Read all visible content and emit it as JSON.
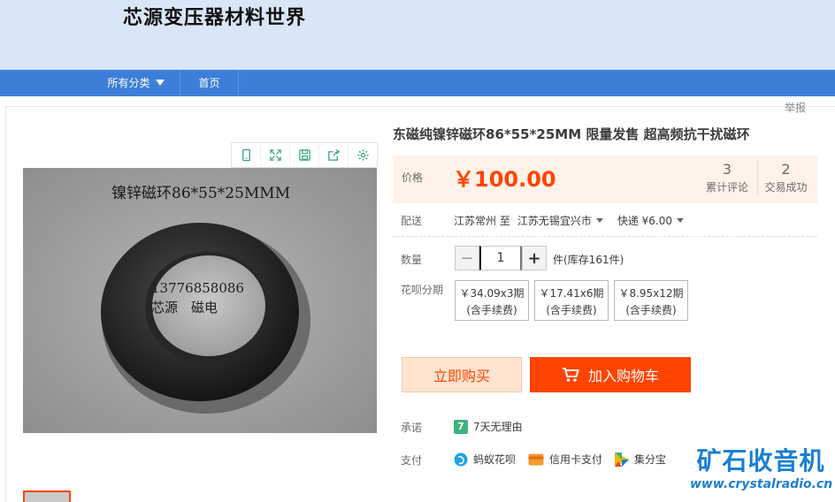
{
  "shop": {
    "title": "芯源变压器材料世界"
  },
  "nav": {
    "all_categories": "所有分类",
    "home": "首页"
  },
  "report_link": "举报",
  "toolbar": {
    "icons": [
      "phone-icon",
      "fullscreen-icon",
      "save-icon",
      "share-icon",
      "settings-icon"
    ]
  },
  "image": {
    "caption": "镍锌磁环86*55*25MMM",
    "overlay_line1": "13776858086",
    "overlay_line2": "芯源　磁电"
  },
  "product": {
    "title": "东磁纯镍锌磁环86*55*25MM 限量发售 超高频抗干扰磁环"
  },
  "price": {
    "label": "价格",
    "value": "￥100.00",
    "reviews_count": "3",
    "reviews_label": "累计评论",
    "sold_count": "2",
    "sold_label": "交易成功"
  },
  "shipping": {
    "label": "配送",
    "from": "江苏常州 至",
    "to": "江苏无锡宜兴市",
    "method": "快递 ¥6.00"
  },
  "quantity": {
    "label": "数量",
    "minus": "−",
    "plus": "+",
    "value": "1",
    "stock": "件(库存161件)"
  },
  "installment": {
    "label": "花呗分期",
    "options": [
      {
        "price": "￥34.09x3期",
        "note": "(含手续费)"
      },
      {
        "price": "￥17.41x6期",
        "note": "(含手续费)"
      },
      {
        "price": "￥8.95x12期",
        "note": "(含手续费)"
      }
    ]
  },
  "actions": {
    "buy_now": "立即购买",
    "add_cart": "加入购物车"
  },
  "promise": {
    "label": "承诺",
    "badge": "7",
    "text": "7天无理由"
  },
  "payment": {
    "label": "支付",
    "methods": [
      "蚂蚁花呗",
      "信用卡支付",
      "集分宝"
    ]
  },
  "watermark": {
    "name": "矿石收音机",
    "url": "www.crystalradio.cn"
  },
  "colors": {
    "accent": "#ff4400",
    "nav": "#3d7fd8",
    "header": "#d9e6f8",
    "watermark": "#1a7fd4"
  }
}
